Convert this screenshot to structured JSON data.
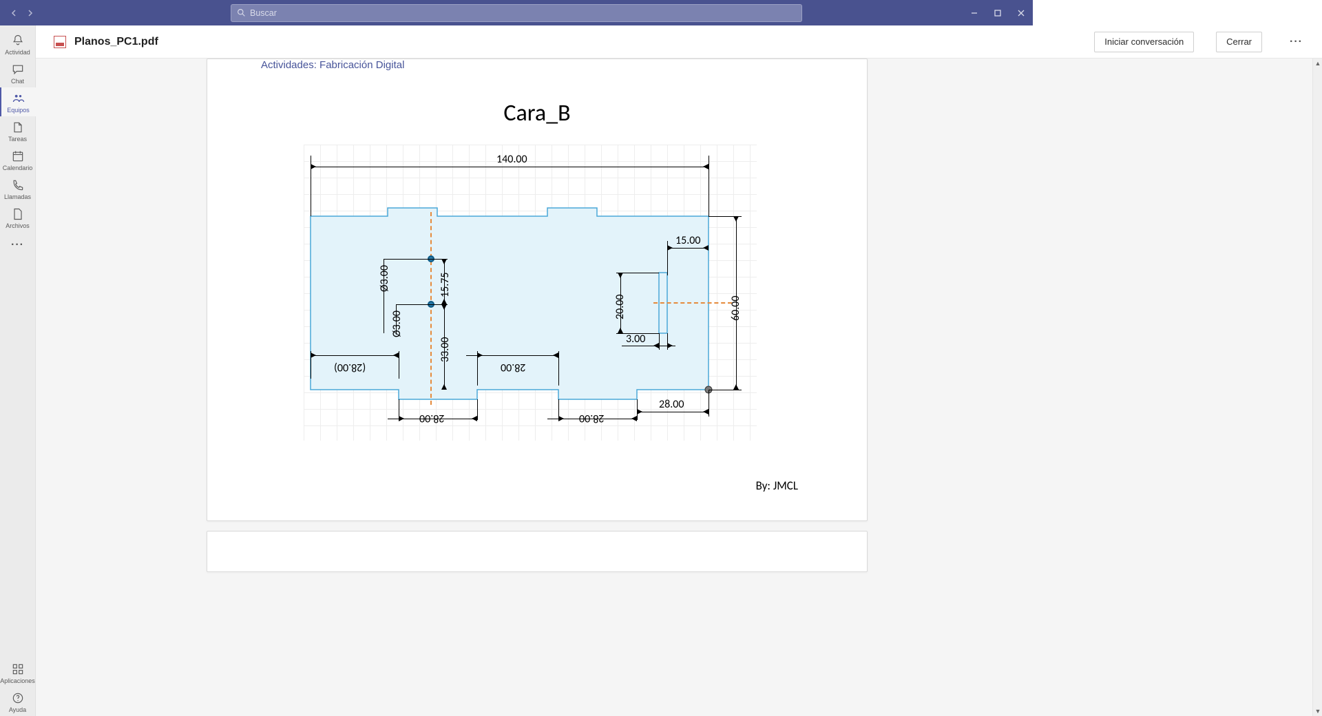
{
  "search": {
    "placeholder": "Buscar"
  },
  "rail": {
    "items": [
      {
        "label": "Actividad"
      },
      {
        "label": "Chat"
      },
      {
        "label": "Equipos"
      },
      {
        "label": "Tareas"
      },
      {
        "label": "Calendario"
      },
      {
        "label": "Llamadas"
      },
      {
        "label": "Archivos"
      }
    ],
    "apps_label": "Aplicaciones",
    "help_label": "Ayuda"
  },
  "header": {
    "filename": "Planos_PC1.pdf",
    "start_conversation": "Iniciar conversación",
    "close": "Cerrar"
  },
  "document": {
    "section_header": "Actividades: Fabricación Digital",
    "drawing_title": "Cara_B",
    "byline": "By: JMCL",
    "dims": {
      "width": "140.00",
      "height": "60.00",
      "right_inset": "15.00",
      "slot_h": "20.00",
      "slot_w": "3.00",
      "bottom_right": "28.00",
      "bottom_tab1": "28.00",
      "bottom_tab2": "28.00",
      "mid_span": "28.00",
      "left_span": "(28.00)",
      "hole_gap": "15.75",
      "hole_to_edge": "33.00",
      "dia1": "Ø3.00",
      "dia2": "Ø3.00"
    }
  }
}
